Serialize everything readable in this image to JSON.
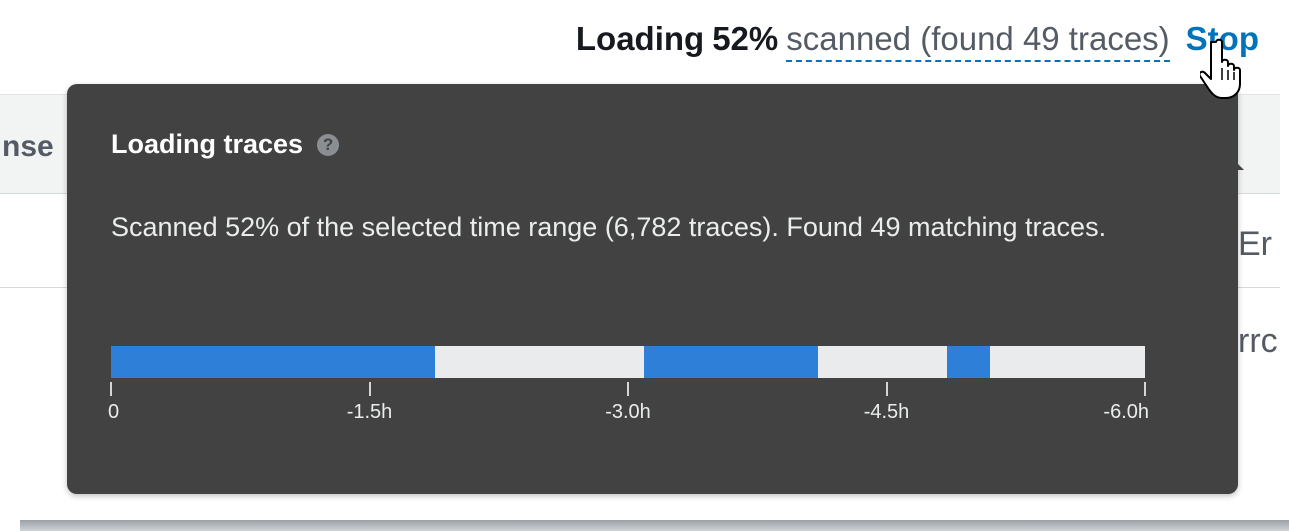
{
  "background": {
    "header_fragment": "nse",
    "cell_fragment_1": "Er",
    "cell_fragment_2": "rrc"
  },
  "status": {
    "loading_label": "Loading",
    "percent": "52%",
    "scanned_text": "scanned (found 49 traces)",
    "stop_label": "Stop"
  },
  "popover": {
    "title": "Loading traces",
    "help_icon": "?",
    "body": "Scanned 52% of the selected time range (6,782 traces). Found 49 matching traces.",
    "timeline": {
      "ticks": [
        "0",
        "-1.5h",
        "-3.0h",
        "-4.5h",
        "-6.0h"
      ],
      "range_hours": [
        0,
        -6.0
      ],
      "scanned_segments_hours": [
        [
          0,
          -1.88
        ],
        [
          -3.09,
          -4.1
        ],
        [
          -4.85,
          -5.1
        ]
      ],
      "scanned_color": "#2e7fd8",
      "unscanned_color": "#e9ebed"
    }
  },
  "colors": {
    "popover_bg": "#424242",
    "link": "#0073bb"
  }
}
